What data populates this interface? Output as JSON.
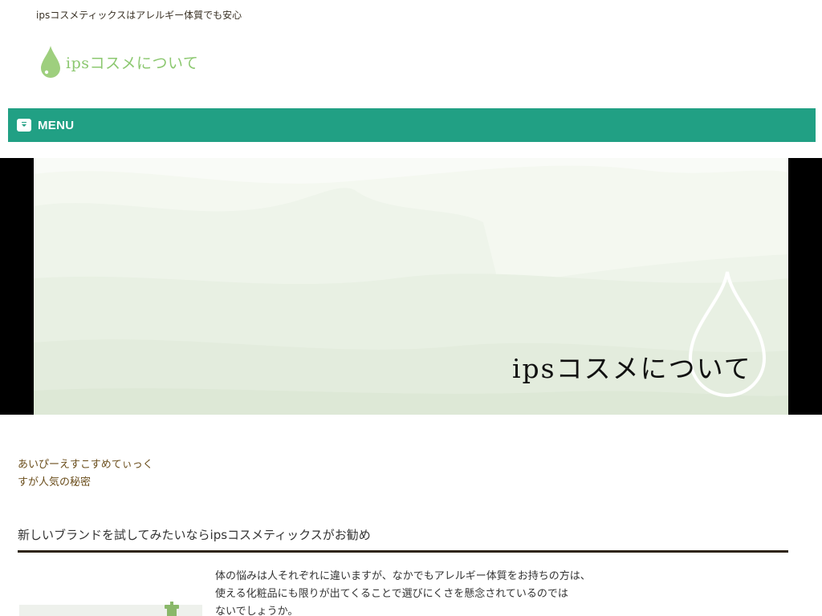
{
  "header": {
    "tagline": "ipsコスメティックスはアレルギー体質でも安心",
    "logo_text": "ipsコスメについて"
  },
  "nav": {
    "menu_label": "MENU"
  },
  "hero": {
    "title": "ipsコスメについて"
  },
  "sidebar": {
    "title_line1": "あいぴーえすこすめてぃっく",
    "title_line2": "すが人気の秘密"
  },
  "article": {
    "heading": "新しいブランドを試してみたいならipsコスメティックスがお勧め",
    "body_lines": [
      "体の悩みは人それぞれに違いますが、なかでもアレルギー体質をお持ちの方は、",
      "使える化粧品にも限りが出てくることで選びにくさを懸念されているのでは",
      "ないでしょうか。"
    ]
  },
  "colors": {
    "nav_bg": "#21a084",
    "logo_green": "#8cc870",
    "heading_rule": "#2e2414",
    "sidebar_title": "#6b4e1c"
  },
  "icons": {
    "logo": "water-drop-icon",
    "menu": "menu-toggle-icon"
  }
}
